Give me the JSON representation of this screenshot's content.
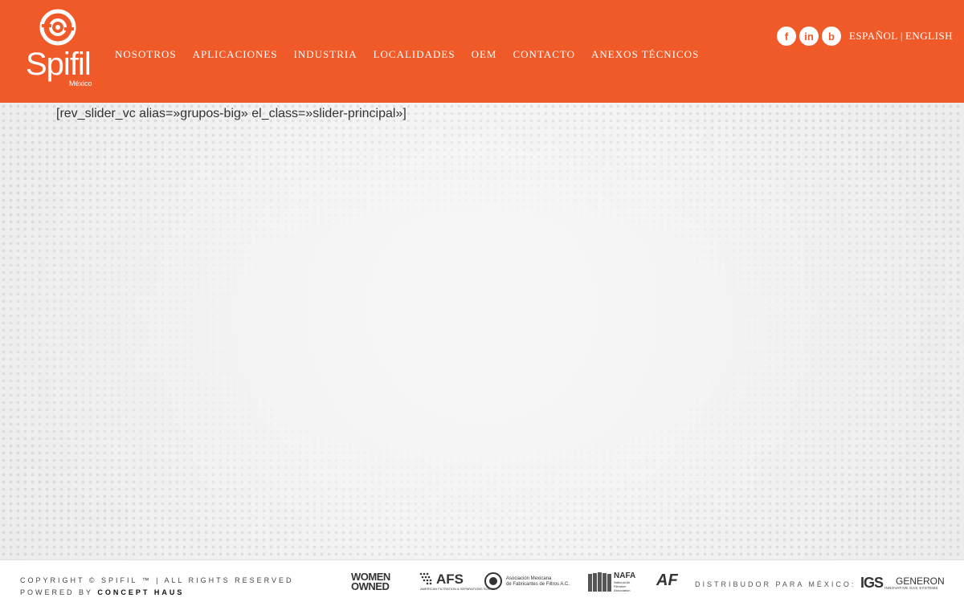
{
  "brand": {
    "name": "Spifil",
    "subtitle": "México",
    "accent_color": "#f05a28"
  },
  "nav": {
    "items": [
      {
        "label": "NOSOTROS"
      },
      {
        "label": "APLICACIONES"
      },
      {
        "label": "INDUSTRIA"
      },
      {
        "label": "LOCALIDADES"
      },
      {
        "label": "OEM"
      },
      {
        "label": "CONTACTO"
      },
      {
        "label": "ANEXOS TÉCNICOS"
      }
    ]
  },
  "social": {
    "facebook": {
      "glyph": "f",
      "icon": "facebook-icon"
    },
    "linkedin": {
      "glyph": "in",
      "icon": "linkedin-icon"
    },
    "blog": {
      "glyph": "b",
      "icon": "blog-icon"
    }
  },
  "lang": {
    "es": "ESPAÑOL",
    "separator": "|",
    "en": "ENGLISH"
  },
  "content": {
    "shortcode": "[rev_slider_vc alias=»grupos-big» el_class=»slider-principal»]"
  },
  "footer": {
    "copyright": "COPYRIGHT © SPIFIL ™ | ALL RIGHTS RESERVED",
    "powered_prefix": "POWERED BY",
    "powered_by": "CONCEPT HAUS",
    "distributor_label": "DISTRIBUDOR PARA MÉXICO:",
    "logos": {
      "women_line1": "WOMEN",
      "women_line2": "OWNED",
      "afs": "AFS",
      "afs_sub": "AMERICAN FILTRATION & SEPARATIONS SOCIETY",
      "amff_line1": "Asociación Mexicana",
      "amff_line2": "de Fabricantes de Filtros A.C.",
      "nafa": "NAFA",
      "nafa_sub1": "National Air",
      "nafa_sub2": "Filtration",
      "nafa_sub3": "Association",
      "af": "AF",
      "igs": "IGS",
      "generon": "GENERON",
      "generon_sub": "INNOVATIVE GAS SYSTEMS"
    }
  }
}
